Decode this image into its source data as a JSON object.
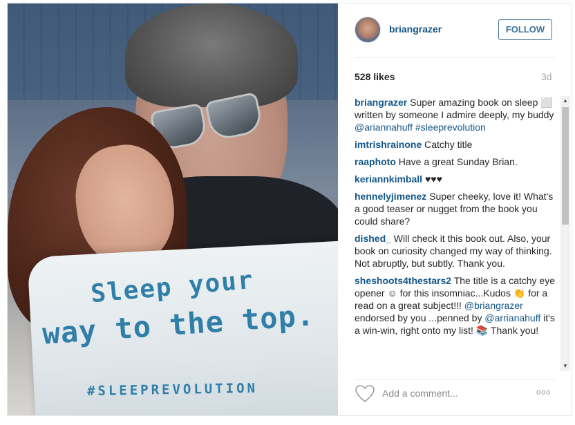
{
  "post": {
    "photo_lines": [
      "Sleep your",
      "way to the top.",
      "#SLEEPREVOLUTION"
    ],
    "username": "briangrazer",
    "follow_label": "FOLLOW",
    "likes": "528 likes",
    "time": "3d",
    "add_comment_placeholder": "Add a comment...",
    "more_label": "ooo"
  },
  "comments": [
    {
      "author": "briangrazer",
      "segments": [
        {
          "t": "Super amazing book on sleep ⬜ written by someone I admire deeply, my buddy ",
          "k": "text"
        },
        {
          "t": "@ariannahuff",
          "k": "mention"
        },
        {
          "t": " ",
          "k": "text"
        },
        {
          "t": "#sleeprevolution",
          "k": "mention"
        }
      ]
    },
    {
      "author": "imtrishrainone",
      "segments": [
        {
          "t": "Catchy title",
          "k": "text"
        }
      ]
    },
    {
      "author": "raaphoto",
      "segments": [
        {
          "t": "Have a great Sunday Brian.",
          "k": "text"
        }
      ]
    },
    {
      "author": "keriannkimball",
      "segments": [
        {
          "t": "♥♥♥",
          "k": "text"
        }
      ]
    },
    {
      "author": "hennelyjimenez",
      "segments": [
        {
          "t": "Super cheeky, love it! What's a good teaser or nugget from the book you could share?",
          "k": "text"
        }
      ]
    },
    {
      "author": "dished_",
      "segments": [
        {
          "t": "Will check it this book out. Also, your book on curiosity changed my way of thinking. Not abruptly, but subtly. Thank you.",
          "k": "text"
        }
      ]
    },
    {
      "author": "sheshoots4thestars2",
      "segments": [
        {
          "t": "The title is a catchy eye opener ☺ for this insomniac...Kudos 👏 for a read on a great subject!!! ",
          "k": "text"
        },
        {
          "t": "@briangrazer",
          "k": "mention"
        },
        {
          "t": " endorsed by you ...penned by ",
          "k": "text"
        },
        {
          "t": "@arrianahuff",
          "k": "mention"
        },
        {
          "t": " it's a win-win, right onto my list! 📚 Thank you!",
          "k": "text"
        }
      ]
    }
  ],
  "colors": {
    "link": "#125688",
    "follow_border": "#3f729b",
    "muted": "#a5a7aa",
    "pillow_text": "#2f7fa8"
  },
  "icons": [
    "heart-icon",
    "more-options-icon",
    "scroll-up-icon",
    "scroll-down-icon"
  ]
}
